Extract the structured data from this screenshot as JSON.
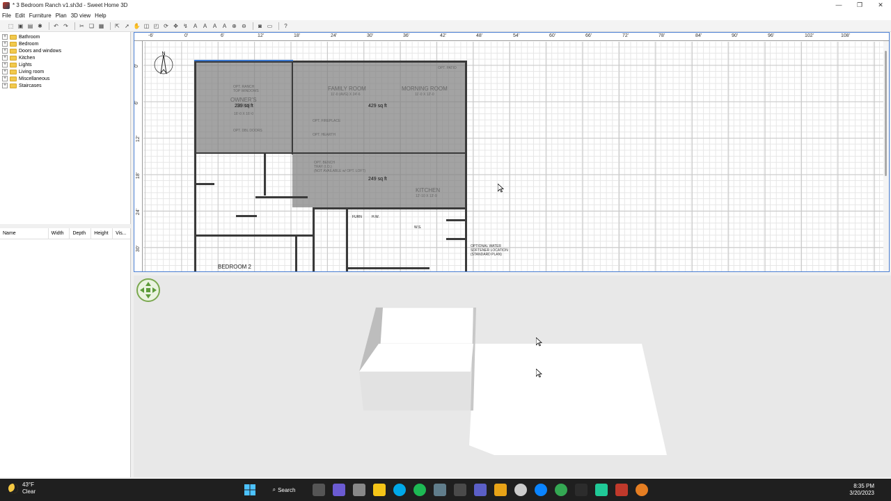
{
  "window": {
    "title": "* 3 Bedroom Ranch v1.sh3d - Sweet Home 3D",
    "controls": [
      "—",
      "❐",
      "✕"
    ]
  },
  "menu": [
    "File",
    "Edit",
    "Furniture",
    "Plan",
    "3D view",
    "Help"
  ],
  "catalog": {
    "categories": [
      "Bathroom",
      "Bedroom",
      "Doors and windows",
      "Kitchen",
      "Lights",
      "Living room",
      "Miscellaneous",
      "Staircases"
    ]
  },
  "furniture_table": {
    "columns": [
      "Name",
      "Width",
      "Depth",
      "Height",
      "Vis..."
    ]
  },
  "plan": {
    "ruler_x": [
      "-6'",
      "0'",
      "6'",
      "12'",
      "18'",
      "24'",
      "30'",
      "36'",
      "42'",
      "48'",
      "54'",
      "60'",
      "66'",
      "72'",
      "78'",
      "84'",
      "90'",
      "96'",
      "102'",
      "108'"
    ],
    "ruler_y": [
      "0'",
      "6'",
      "12'",
      "18'",
      "24'",
      "30'"
    ],
    "rooms": {
      "owners_area": "239 sq ft",
      "family_area": "429 sq ft",
      "kitchen_area": "249 sq ft"
    },
    "image_labels": {
      "family_room": "FAMILY ROOM",
      "family_room_dim": "11'-0 (AVG) X 24'-6",
      "morning_room": "MORNING ROOM",
      "morning_room_dim": "11'-0 X 12'-0",
      "owners": "OWNER'S",
      "suite": "SUITE",
      "owners_dim": "16'-0 X 16'-0",
      "kitchen": "KITCHEN",
      "kitchen_dim": "12'-10 X 13'-9",
      "bedroom2": "BEDROOM 2",
      "furn": "FURN",
      "hw": "H.W.",
      "ws": "W.S.",
      "water_softener_1": "OPTIONAL WATER",
      "water_softener_2": "SOFTENER LOCATION",
      "water_softener_3": "(STANDARD PLAN)",
      "opt_fireplace": "OPT. FIREPLACE",
      "opt_hearth": "OPT. HEARTH",
      "opt_patio": "OPT. PATIO",
      "opt_bench_1": "OPT. BENCH",
      "opt_bench_2": "TRAY (I.O.)",
      "opt_bench_3": "(NOT AVAILABLE w/ OPT. LOFT)",
      "opt_ranch": "OPT. RANCH",
      "opt_windows": "TOP WINDOWS",
      "opt_dbl_doors": "OPT. DBL DOORS"
    },
    "compass_letter": "N"
  },
  "taskbar": {
    "weather_temp": "43°F",
    "weather_desc": "Clear",
    "search_label": "Search",
    "time": "8:35 PM",
    "date": "3/20/2023",
    "icon_colors": [
      "#0078d4",
      "#555555",
      "#6b5bd2",
      "#888888",
      "#f5c518",
      "#00a8e8",
      "#1db954",
      "#607d8b",
      "#4a4a4a",
      "#5b5fc7",
      "#e8a317",
      "#cccccc",
      "#0a84ff",
      "#34a853",
      "#2c2c2c",
      "#20c997",
      "#c0392b",
      "#e67e22"
    ]
  }
}
